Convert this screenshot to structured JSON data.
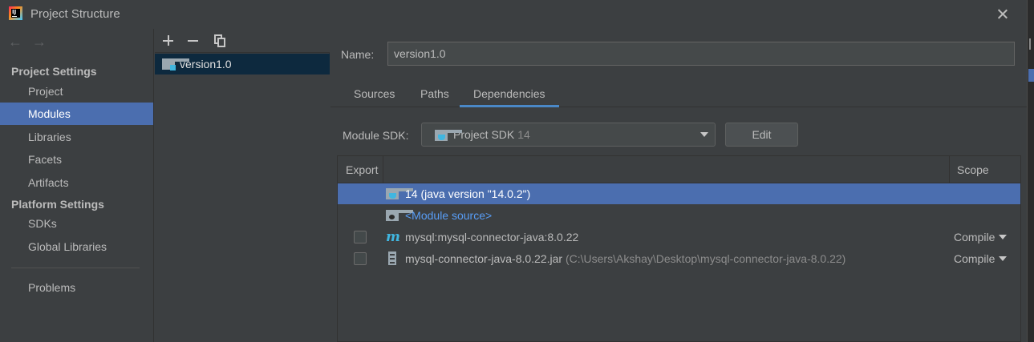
{
  "window": {
    "title": "Project Structure"
  },
  "leftnav": {
    "back": "←",
    "forward": "→",
    "project_settings_heading": "Project Settings",
    "project_items": [
      "Project",
      "Modules",
      "Libraries",
      "Facets",
      "Artifacts"
    ],
    "platform_settings_heading": "Platform Settings",
    "platform_items": [
      "SDKs",
      "Global Libraries"
    ],
    "problems": "Problems",
    "selected": "Modules"
  },
  "modules": {
    "items": [
      "version1.0"
    ]
  },
  "module": {
    "name_label": "Name:",
    "name_value": "version1.0",
    "tabs": [
      "Sources",
      "Paths",
      "Dependencies"
    ],
    "active_tab": "Dependencies",
    "sdk_label": "Module SDK:",
    "sdk_value": "Project SDK",
    "sdk_version": "14",
    "edit_label": "Edit"
  },
  "dependencies": {
    "headers": {
      "export": "Export",
      "scope": "Scope"
    },
    "rows": [
      {
        "text": "14 (java version \"14.0.2\")",
        "icon": "jdk-folder-icon",
        "selected": true
      },
      {
        "text": "<Module source>",
        "icon": "module-source-icon",
        "link": true
      },
      {
        "text": "mysql:mysql-connector-java:8.0.22",
        "icon": "maven-icon",
        "export": false,
        "scope": "Compile"
      },
      {
        "text": "mysql-connector-java-8.0.22.jar",
        "path": "(C:\\Users\\Akshay\\Desktop\\mysql-connector-java-8.0.22)",
        "icon": "jar-icon",
        "export": false,
        "scope": "Compile"
      }
    ]
  },
  "colors": {
    "background": "#3c3f41",
    "selection": "#4b6eaf",
    "accent": "#4a88c7",
    "link": "#589df6"
  }
}
